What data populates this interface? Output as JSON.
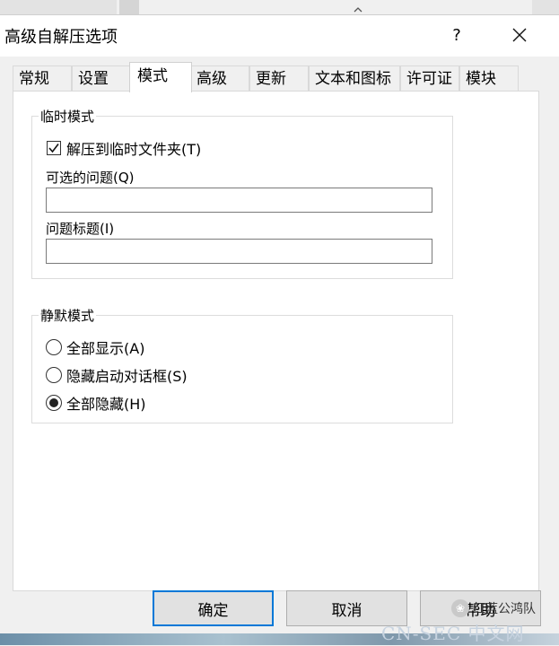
{
  "window": {
    "title": "高级自解压选项",
    "help_glyph": "?"
  },
  "tabs": [
    {
      "label": "常规"
    },
    {
      "label": "设置"
    },
    {
      "label": "模式"
    },
    {
      "label": "高级"
    },
    {
      "label": "更新"
    },
    {
      "label": "文本和图标"
    },
    {
      "label": "许可证"
    },
    {
      "label": "模块"
    }
  ],
  "active_tab": "模式",
  "temp_mode": {
    "legend": "临时模式",
    "extract_to_temp": {
      "label": "解压到临时文件夹(T)",
      "checked": true
    },
    "optional_question": {
      "label": "可选的问题(Q)",
      "value": ""
    },
    "question_title": {
      "label": "问题标题(I)",
      "value": ""
    }
  },
  "silent_mode": {
    "legend": "静默模式",
    "options": [
      {
        "label": "全部显示(A)",
        "selected": false
      },
      {
        "label": "隐藏启动对话框(S)",
        "selected": false
      },
      {
        "label": "全部隐藏(H)",
        "selected": true
      }
    ]
  },
  "buttons": {
    "ok": "确定",
    "cancel": "取消",
    "help": "帮助"
  },
  "watermark": {
    "account": "红蓝公鸿队",
    "site": "CN-SEC 中文网"
  },
  "colors": {
    "focus_border": "#0078d7",
    "button_bg": "#e1e1e1",
    "dialog_bg": "#f0f0f0"
  }
}
